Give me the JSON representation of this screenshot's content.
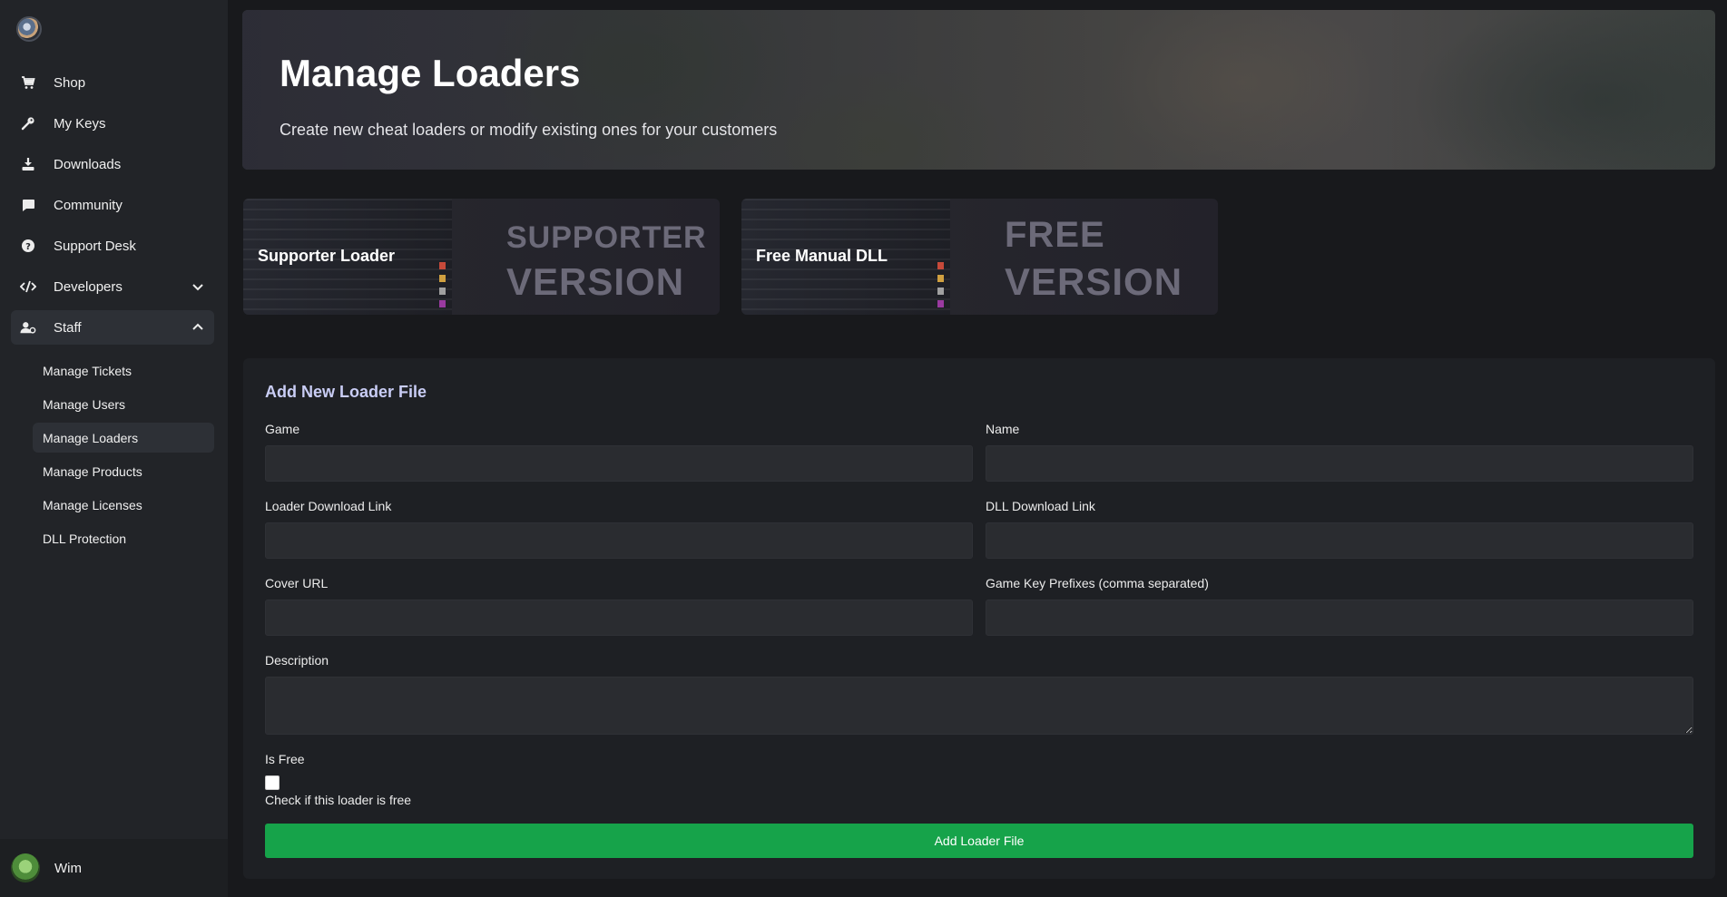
{
  "sidebar": {
    "items": [
      {
        "label": "Shop",
        "icon": "cart-icon"
      },
      {
        "label": "My Keys",
        "icon": "key-icon"
      },
      {
        "label": "Downloads",
        "icon": "download-icon"
      },
      {
        "label": "Community",
        "icon": "chat-icon"
      },
      {
        "label": "Support Desk",
        "icon": "help-icon"
      },
      {
        "label": "Developers",
        "icon": "code-icon",
        "expanded": false
      },
      {
        "label": "Staff",
        "icon": "staff-icon",
        "expanded": true
      }
    ],
    "staff_items": [
      {
        "label": "Manage Tickets"
      },
      {
        "label": "Manage Users"
      },
      {
        "label": "Manage Loaders",
        "active": true
      },
      {
        "label": "Manage Products"
      },
      {
        "label": "Manage Licenses"
      },
      {
        "label": "DLL Protection"
      }
    ]
  },
  "user": {
    "name": "Wim"
  },
  "banner": {
    "title": "Manage Loaders",
    "subtitle": "Create new cheat loaders or modify existing ones for your customers"
  },
  "loaders": [
    {
      "label": "Supporter Loader",
      "overlay_line1": "SUPPORTER",
      "overlay_line2": "VERSION"
    },
    {
      "label": "Free Manual DLL",
      "overlay_line1": "FREE",
      "overlay_line2": "VERSION"
    }
  ],
  "form": {
    "title": "Add New Loader File",
    "game_label": "Game",
    "name_label": "Name",
    "loader_link_label": "Loader Download Link",
    "dll_link_label": "DLL Download Link",
    "cover_label": "Cover URL",
    "prefixes_label": "Game Key Prefixes (comma separated)",
    "description_label": "Description",
    "is_free_label": "Is Free",
    "is_free_checked": false,
    "is_free_help": "Check if this loader is free",
    "submit_label": "Add Loader File"
  },
  "colors": {
    "accent_green": "#16a34a",
    "panel_title": "#c9cdf5",
    "sidebar_bg": "#222428",
    "page_bg": "#18191c"
  }
}
